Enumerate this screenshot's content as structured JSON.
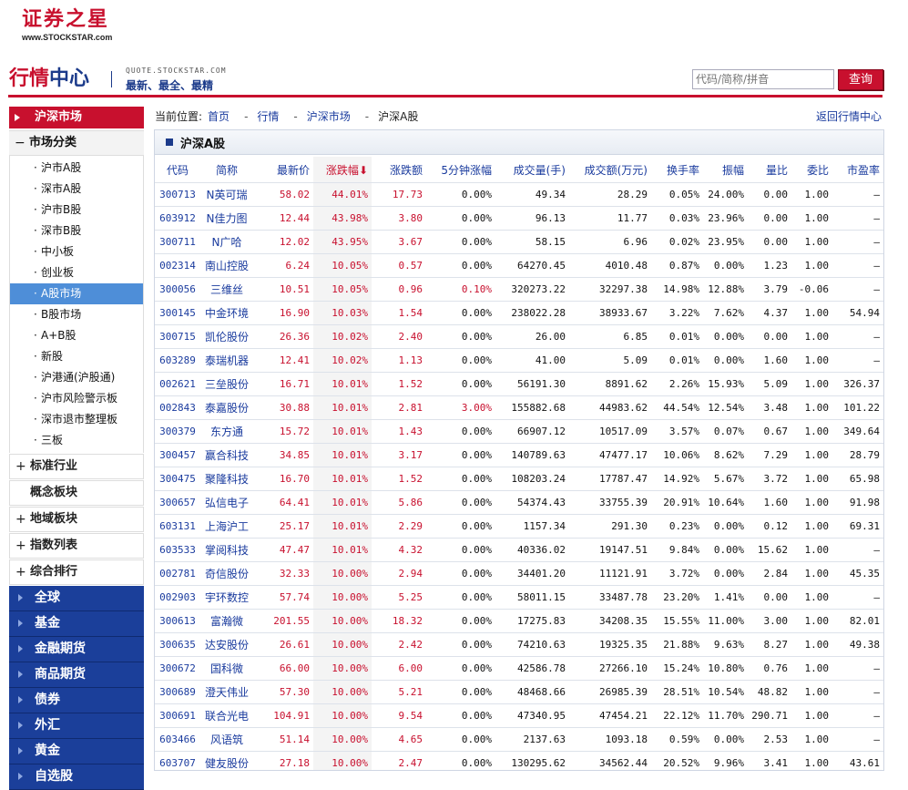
{
  "logo": {
    "brand": "证券之星",
    "url": "www.STOCKSTAR.com"
  },
  "header": {
    "title_part1": "行情",
    "title_part2": "中心",
    "quote_url": "QUOTE.STOCKSTAR.COM",
    "slogan": "最新、最全、最精",
    "search_placeholder": "代码/简称/拼音",
    "search_button": "查询"
  },
  "sidebar": {
    "header": "沪深市场",
    "category_open": {
      "symbol": "−",
      "label": "市场分类"
    },
    "sub_items": [
      "沪市A股",
      "深市A股",
      "沪市B股",
      "深市B股",
      "中小板",
      "创业板",
      "A股市场",
      "B股市场",
      "A+B股",
      "新股",
      "沪港通(沪股通)",
      "沪市风险警示板",
      "深市退市整理板",
      "三板"
    ],
    "active_item": "A股市场",
    "gray_categories": [
      {
        "symbol": "+",
        "label": "标准行业"
      },
      {
        "symbol": "",
        "label": "概念板块"
      },
      {
        "symbol": "+",
        "label": "地域板块"
      },
      {
        "symbol": "+",
        "label": "指数列表"
      },
      {
        "symbol": "+",
        "label": "综合排行"
      }
    ],
    "blue_categories": [
      "全球",
      "基金",
      "金融期货",
      "商品期货",
      "债券",
      "外汇",
      "黄金",
      "自选股"
    ]
  },
  "breadcrumb": {
    "prefix": "当前位置:",
    "items": [
      "首页",
      "行情",
      "沪深市场",
      "沪深A股"
    ],
    "back_link": "返回行情中心"
  },
  "panel_title": "沪深A股",
  "table": {
    "columns": [
      "代码",
      "简称",
      "最新价",
      "涨跌幅",
      "涨跌额",
      "5分钟涨幅",
      "成交量(手)",
      "成交额(万元)",
      "换手率",
      "振幅",
      "量比",
      "委比",
      "市盈率"
    ],
    "sort_indicator": "⬇",
    "rows": [
      [
        "300713",
        "N英可瑞",
        "58.02",
        "44.01%",
        "17.73",
        "0.00%",
        "49.34",
        "28.29",
        "0.05%",
        "24.00%",
        "0.00",
        "1.00",
        "—"
      ],
      [
        "603912",
        "N佳力图",
        "12.44",
        "43.98%",
        "3.80",
        "0.00%",
        "96.13",
        "11.77",
        "0.03%",
        "23.96%",
        "0.00",
        "1.00",
        "—"
      ],
      [
        "300711",
        "N广哈",
        "12.02",
        "43.95%",
        "3.67",
        "0.00%",
        "58.15",
        "6.96",
        "0.02%",
        "23.95%",
        "0.00",
        "1.00",
        "—"
      ],
      [
        "002314",
        "南山控股",
        "6.24",
        "10.05%",
        "0.57",
        "0.00%",
        "64270.45",
        "4010.48",
        "0.87%",
        "0.00%",
        "1.23",
        "1.00",
        "—"
      ],
      [
        "300056",
        "三维丝",
        "10.51",
        "10.05%",
        "0.96",
        "0.10%",
        "320273.22",
        "32297.38",
        "14.98%",
        "12.88%",
        "3.79",
        "-0.06",
        "—"
      ],
      [
        "300145",
        "中金环境",
        "16.90",
        "10.03%",
        "1.54",
        "0.00%",
        "238022.28",
        "38933.67",
        "3.22%",
        "7.62%",
        "4.37",
        "1.00",
        "54.94"
      ],
      [
        "300715",
        "凯伦股份",
        "26.36",
        "10.02%",
        "2.40",
        "0.00%",
        "26.00",
        "6.85",
        "0.01%",
        "0.00%",
        "0.00",
        "1.00",
        "—"
      ],
      [
        "603289",
        "泰瑞机器",
        "12.41",
        "10.02%",
        "1.13",
        "0.00%",
        "41.00",
        "5.09",
        "0.01%",
        "0.00%",
        "1.60",
        "1.00",
        "—"
      ],
      [
        "002621",
        "三垒股份",
        "16.71",
        "10.01%",
        "1.52",
        "0.00%",
        "56191.30",
        "8891.62",
        "2.26%",
        "15.93%",
        "5.09",
        "1.00",
        "326.37"
      ],
      [
        "002843",
        "泰嘉股份",
        "30.88",
        "10.01%",
        "2.81",
        "3.00%",
        "155882.68",
        "44983.62",
        "44.54%",
        "12.54%",
        "3.48",
        "1.00",
        "101.22"
      ],
      [
        "300379",
        "东方通",
        "15.72",
        "10.01%",
        "1.43",
        "0.00%",
        "66907.12",
        "10517.09",
        "3.57%",
        "0.07%",
        "0.67",
        "1.00",
        "349.64"
      ],
      [
        "300457",
        "赢合科技",
        "34.85",
        "10.01%",
        "3.17",
        "0.00%",
        "140789.63",
        "47477.17",
        "10.06%",
        "8.62%",
        "7.29",
        "1.00",
        "28.79"
      ],
      [
        "300475",
        "聚隆科技",
        "16.70",
        "10.01%",
        "1.52",
        "0.00%",
        "108203.24",
        "17787.47",
        "14.92%",
        "5.67%",
        "3.72",
        "1.00",
        "65.98"
      ],
      [
        "300657",
        "弘信电子",
        "64.41",
        "10.01%",
        "5.86",
        "0.00%",
        "54374.43",
        "33755.39",
        "20.91%",
        "10.64%",
        "1.60",
        "1.00",
        "91.98"
      ],
      [
        "603131",
        "上海沪工",
        "25.17",
        "10.01%",
        "2.29",
        "0.00%",
        "1157.34",
        "291.30",
        "0.23%",
        "0.00%",
        "0.12",
        "1.00",
        "69.31"
      ],
      [
        "603533",
        "掌阅科技",
        "47.47",
        "10.01%",
        "4.32",
        "0.00%",
        "40336.02",
        "19147.51",
        "9.84%",
        "0.00%",
        "15.62",
        "1.00",
        "—"
      ],
      [
        "002781",
        "奇信股份",
        "32.33",
        "10.00%",
        "2.94",
        "0.00%",
        "34401.20",
        "11121.91",
        "3.72%",
        "0.00%",
        "2.84",
        "1.00",
        "45.35"
      ],
      [
        "002903",
        "宇环数控",
        "57.74",
        "10.00%",
        "5.25",
        "0.00%",
        "58011.15",
        "33487.78",
        "23.20%",
        "1.41%",
        "0.00",
        "1.00",
        "—"
      ],
      [
        "300613",
        "富瀚微",
        "201.55",
        "10.00%",
        "18.32",
        "0.00%",
        "17275.83",
        "34208.35",
        "15.55%",
        "11.00%",
        "3.00",
        "1.00",
        "82.01"
      ],
      [
        "300635",
        "达安股份",
        "26.61",
        "10.00%",
        "2.42",
        "0.00%",
        "74210.63",
        "19325.35",
        "21.88%",
        "9.63%",
        "8.27",
        "1.00",
        "49.38"
      ],
      [
        "300672",
        "国科微",
        "66.00",
        "10.00%",
        "6.00",
        "0.00%",
        "42586.78",
        "27266.10",
        "15.24%",
        "10.80%",
        "0.76",
        "1.00",
        "—"
      ],
      [
        "300689",
        "澄天伟业",
        "57.30",
        "10.00%",
        "5.21",
        "0.00%",
        "48468.66",
        "26985.39",
        "28.51%",
        "10.54%",
        "48.82",
        "1.00",
        "—"
      ],
      [
        "300691",
        "联合光电",
        "104.91",
        "10.00%",
        "9.54",
        "0.00%",
        "47340.95",
        "47454.21",
        "22.12%",
        "11.70%",
        "290.71",
        "1.00",
        "—"
      ],
      [
        "603466",
        "风语筑",
        "51.14",
        "10.00%",
        "4.65",
        "0.00%",
        "2137.63",
        "1093.18",
        "0.59%",
        "0.00%",
        "2.53",
        "1.00",
        "—"
      ],
      [
        "603707",
        "健友股份",
        "27.18",
        "10.00%",
        "2.47",
        "0.00%",
        "130295.62",
        "34562.44",
        "20.52%",
        "9.96%",
        "3.41",
        "1.00",
        "43.61"
      ]
    ]
  }
}
